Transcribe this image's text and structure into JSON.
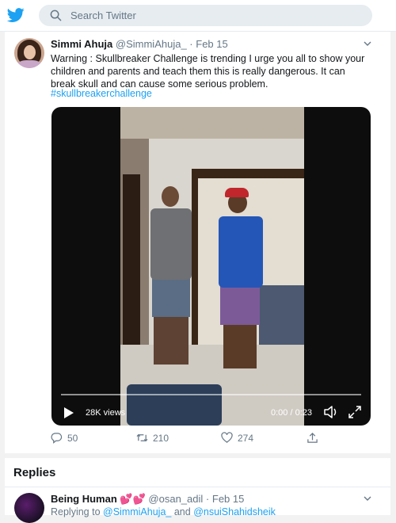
{
  "colors": {
    "accent": "#1da1f2",
    "muted": "#657786",
    "text": "#14171a",
    "heart": "#e0245e"
  },
  "topbar": {
    "logo_icon": "twitter-bird-icon",
    "search_placeholder": "Search Twitter"
  },
  "tweet": {
    "author_name": "Simmi Ahuja",
    "author_handle": "@SimmiAhuja_",
    "separator": "·",
    "date": "Feb 15",
    "text": "Warning : Skullbreaker Challenge is trending I urge you all to show your children and parents and teach them this is really dangerous. It can break skull and can cause some serious problem.",
    "hashtag": "#skullbreakerchallenge",
    "video": {
      "views": "28K views",
      "time": "0:00 / 0:23",
      "progress": 0
    },
    "actions": {
      "replies": "50",
      "retweets": "210",
      "likes": "274"
    }
  },
  "replies_section": {
    "title": "Replies",
    "reply": {
      "author_name": "Being Human",
      "emoji": "💕💕",
      "author_handle": "@osan_adil",
      "separator": "·",
      "date": "Feb 15",
      "replying_prefix": "Replying to",
      "replying_to_1": "@SimmiAhuja_",
      "replying_and": "and",
      "replying_to_2": "@nsuiShahidsheik"
    }
  }
}
